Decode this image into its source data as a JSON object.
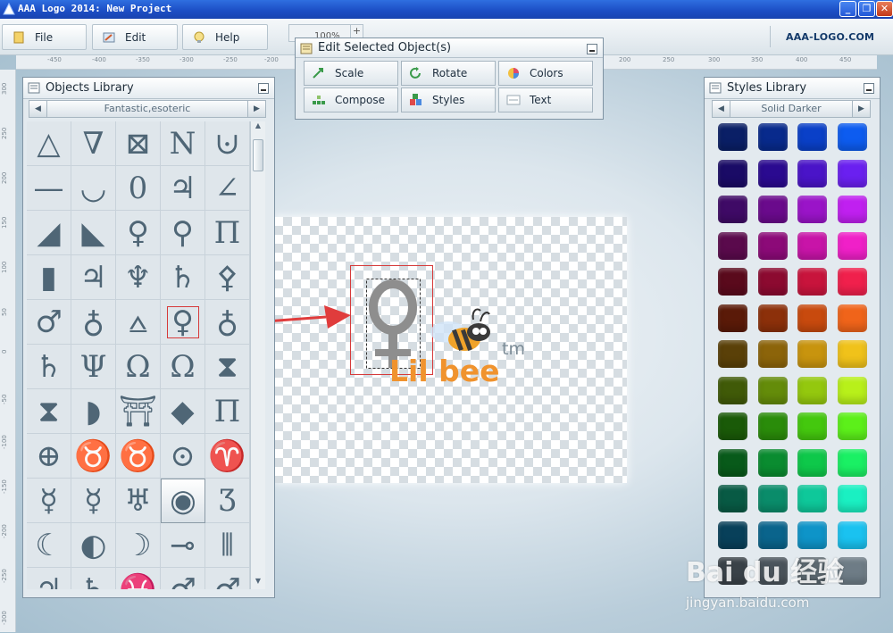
{
  "window": {
    "title": "AAA Logo 2014: New Project",
    "controls": {
      "minimize": "_",
      "restore": "❐",
      "close": "✕"
    }
  },
  "menu": {
    "items": [
      {
        "label": "File",
        "icon": "file-icon"
      },
      {
        "label": "Edit",
        "icon": "edit-icon"
      },
      {
        "label": "Help",
        "icon": "help-icon"
      }
    ],
    "brand": "AAA-LOGO.COM"
  },
  "zoom": {
    "value": "100%",
    "plus": "+"
  },
  "rulers": {
    "top": [
      "-450",
      "-400",
      "-350",
      "-300",
      "-250",
      "-200",
      "200",
      "250",
      "300",
      "350",
      "400",
      "450"
    ],
    "left": [
      "300",
      "250",
      "200",
      "150",
      "100",
      "50",
      "0",
      "-50",
      "-100",
      "-150",
      "-200",
      "-250",
      "-300"
    ]
  },
  "edit_panel": {
    "title": "Edit Selected Object(s)",
    "buttons": [
      {
        "label": "Scale",
        "icon": "scale-icon"
      },
      {
        "label": "Rotate",
        "icon": "rotate-icon"
      },
      {
        "label": "Colors",
        "icon": "colors-icon"
      },
      {
        "label": "Compose",
        "icon": "compose-icon"
      },
      {
        "label": "Styles",
        "icon": "styles-icon"
      },
      {
        "label": "Text",
        "icon": "text-icon"
      }
    ]
  },
  "objects_library": {
    "title": "Objects Library",
    "category": "Fantastic,esoteric",
    "prev": "◀",
    "next": "▶",
    "symbols": [
      "△",
      "∇",
      "⊠",
      "N",
      "⊍",
      "—",
      "◡",
      "0",
      "♃",
      "∠",
      "◢",
      "◣",
      "♀",
      "⚲",
      "Π",
      "▮",
      "♃",
      "♆",
      "♄",
      "⚴",
      "♂",
      "♁",
      "⩟",
      "♀",
      "♁",
      "♄",
      "Ψ",
      "Ω",
      "Ω",
      "⧗",
      "⧗",
      "◗",
      "⛩",
      "◆",
      "Π",
      "⊕",
      "♉",
      "♉",
      "⊙",
      "♈",
      "☿",
      "☿",
      "♅",
      "◉",
      "Ʒ",
      "☾",
      "◐",
      "☽",
      "⊸",
      "⦀",
      "♃",
      "♄",
      "♓",
      "♂",
      "♂"
    ],
    "selected_index": 23,
    "pressed_index": 43
  },
  "styles_library": {
    "title": "Styles Library",
    "category": "Solid Darker",
    "prev": "◀",
    "next": "▶",
    "swatches": [
      "#0a1f66",
      "#082a8c",
      "#0a40c8",
      "#0d5cf0",
      "#1a0b66",
      "#2a0a90",
      "#4a14c8",
      "#6a20f0",
      "#3f0a66",
      "#6a0a8c",
      "#9a14c8",
      "#c020f0",
      "#5a0a4c",
      "#8c0a78",
      "#c814a8",
      "#f020c8",
      "#5a0a1c",
      "#8c0a30",
      "#c8143c",
      "#f0204c",
      "#5a1a08",
      "#8c300a",
      "#c84a0e",
      "#f0641a",
      "#5a4008",
      "#8c640a",
      "#c8940e",
      "#f0c21a",
      "#405a08",
      "#648c0a",
      "#94c80e",
      "#b8f01a",
      "#1a5a08",
      "#2a8c0a",
      "#44c80e",
      "#5cf01a",
      "#085a1a",
      "#0a8c30",
      "#0ec84a",
      "#1af064",
      "#085a44",
      "#0a8c6a",
      "#0ec89a",
      "#1af0c2",
      "#08405a",
      "#0a648c",
      "#0e94c8",
      "#1ac2f0",
      "#3a4248",
      "#4a545c",
      "#5c6870",
      "#6e7c86"
    ]
  },
  "canvas": {
    "logo_text": "Lil bee",
    "tm": "tm"
  },
  "watermark": {
    "main": "Bai du 经验",
    "sub": "jingyan.baidu.com"
  },
  "colors": {
    "title_bar": "#1d4fc6",
    "brand_text": "#143a6a",
    "highlight_box": "#d63a3a",
    "arrow": "#e03c3c",
    "logo_orange": "#f0932e",
    "symbol_gray": "#4f6676"
  }
}
